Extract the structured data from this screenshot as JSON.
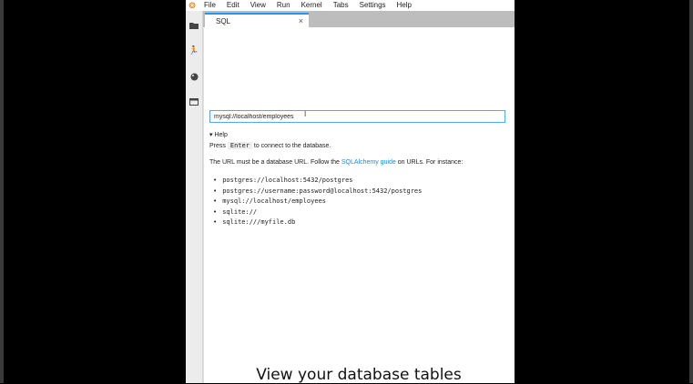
{
  "menu": [
    "File",
    "Edit",
    "View",
    "Run",
    "Kernel",
    "Tabs",
    "Settings",
    "Help"
  ],
  "tab": {
    "label": "SQL",
    "close": "×"
  },
  "input": {
    "value": "mysql://localhost/employees"
  },
  "help": {
    "toggle": "▾ Help",
    "press": "Press",
    "key": "Enter",
    "press_rest": "to connect to the database.",
    "url_pre": "The URL must be a database URL. Follow the",
    "url_link": "SQLAlchemy guide",
    "url_post": "on URLs. For instance:",
    "examples": [
      "postgres://localhost:5432/postgres",
      "postgres://username:password@localhost:5432/postgres",
      "mysql://localhost/employees",
      "sqlite://",
      "sqlite:///myfile.db"
    ]
  },
  "caption": "View your database tables"
}
